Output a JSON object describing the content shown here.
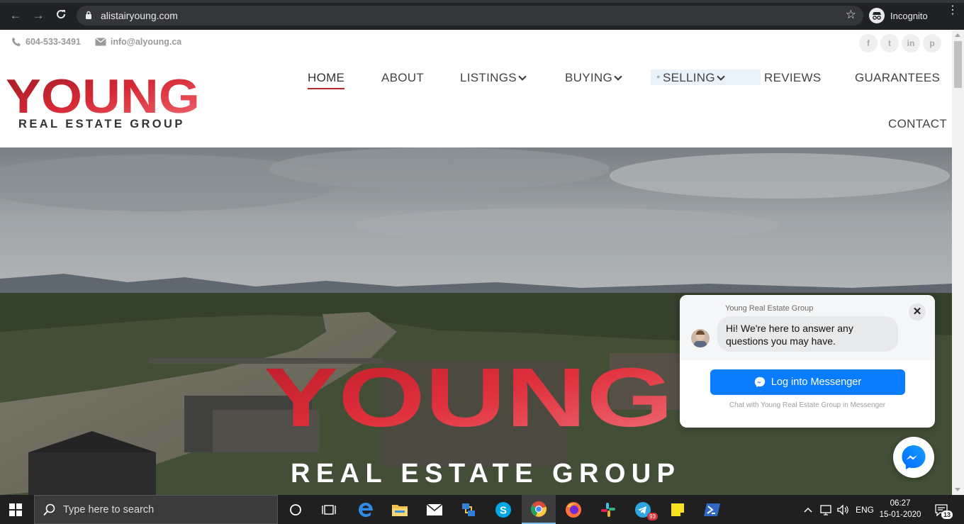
{
  "browser": {
    "url": "alistairyoung.com",
    "mode_label": "Incognito"
  },
  "topbar": {
    "phone": "604-533-3491",
    "email": "info@alyoung.ca",
    "social": [
      "f",
      "t",
      "in",
      "p"
    ]
  },
  "logo": {
    "wordmark": "YOUNG",
    "tagline": "REAL ESTATE GROUP"
  },
  "nav": {
    "items": [
      {
        "label": "HOME",
        "active": true,
        "dropdown": false
      },
      {
        "label": "ABOUT",
        "active": false,
        "dropdown": false
      },
      {
        "label": "LISTINGS",
        "active": false,
        "dropdown": true
      },
      {
        "label": "BUYING",
        "active": false,
        "dropdown": true
      },
      {
        "label": "SELLING",
        "active": false,
        "dropdown": true
      },
      {
        "label": "REVIEWS",
        "active": false,
        "dropdown": false
      },
      {
        "label": "GUARANTEES",
        "active": false,
        "dropdown": false
      },
      {
        "label": "CONTACT",
        "active": false,
        "dropdown": false
      }
    ]
  },
  "hero": {
    "wordmark": "YOUNG",
    "tagline": "REAL ESTATE GROUP"
  },
  "chat": {
    "page_name": "Young Real Estate Group",
    "greeting": "Hi! We're here to answer any questions you may have.",
    "login_label": "Log into Messenger",
    "footer": "Chat with Young Real Estate Group in Messenger"
  },
  "taskbar": {
    "search_placeholder": "Type here to search",
    "language": "ENG",
    "time": "06:27",
    "date": "15-01-2020",
    "telegram_badge": "93",
    "notification_count": "13"
  },
  "colors": {
    "brand_red": "#c8202c",
    "brand_light_red": "#ef4a55",
    "nav_underline": "#b5262b",
    "messenger_blue": "#0a7cff"
  }
}
